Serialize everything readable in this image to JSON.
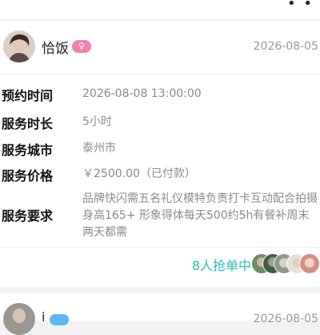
{
  "order": {
    "user_name": "恰饭",
    "gender_symbol": "♀",
    "date": "2026-08-05",
    "fields": [
      {
        "label": "预约时间",
        "value": "2026-08-08 13:00:00"
      },
      {
        "label": "服务时长",
        "value": "5小时"
      },
      {
        "label": "服务城市",
        "value": "泰州市"
      },
      {
        "label": "服务价格",
        "value": "￥2500.00（已付款）"
      },
      {
        "label": "服务要求",
        "value": "品牌快闪需五名礼仪模特负责打卡互动配合拍摄身高165+ 形象得体每天500约5h有餐补周末两天都需"
      }
    ],
    "grab_text": "8人抢单中"
  },
  "next_order": {
    "user_name": "i",
    "date": "2026-08-05"
  },
  "colors": {
    "accent_teal": "#2bbfb3",
    "female_badge": "#f47fb0",
    "male_badge": "#5bb8f0"
  }
}
